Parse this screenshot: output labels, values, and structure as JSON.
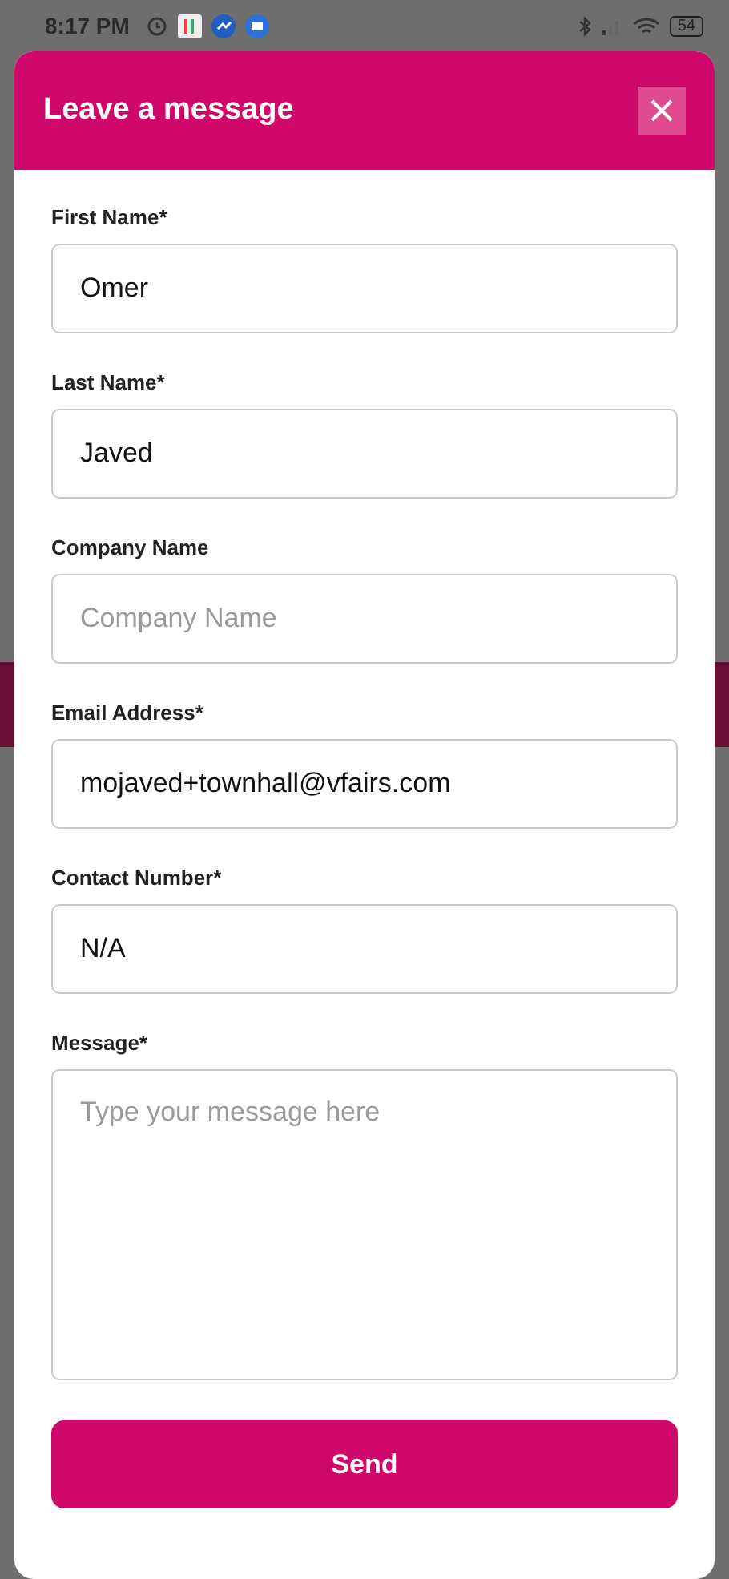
{
  "status_bar": {
    "time": "8:17 PM",
    "battery": "54"
  },
  "dialog": {
    "title": "Leave a message",
    "fields": [
      {
        "kind": "input",
        "label": "First Name*",
        "value": "Omer"
      },
      {
        "kind": "input",
        "label": "Last Name*",
        "value": "Javed"
      },
      {
        "kind": "input",
        "label": "Company Name",
        "placeholder": "Company Name"
      },
      {
        "kind": "input",
        "label": "Email Address*",
        "value": "mojaved+townhall@vfairs.com"
      },
      {
        "kind": "input",
        "label": "Contact Number*",
        "value": "N/A"
      },
      {
        "kind": "textarea",
        "label": "Message*",
        "placeholder": "Type your message here"
      }
    ],
    "submit": "Send"
  }
}
